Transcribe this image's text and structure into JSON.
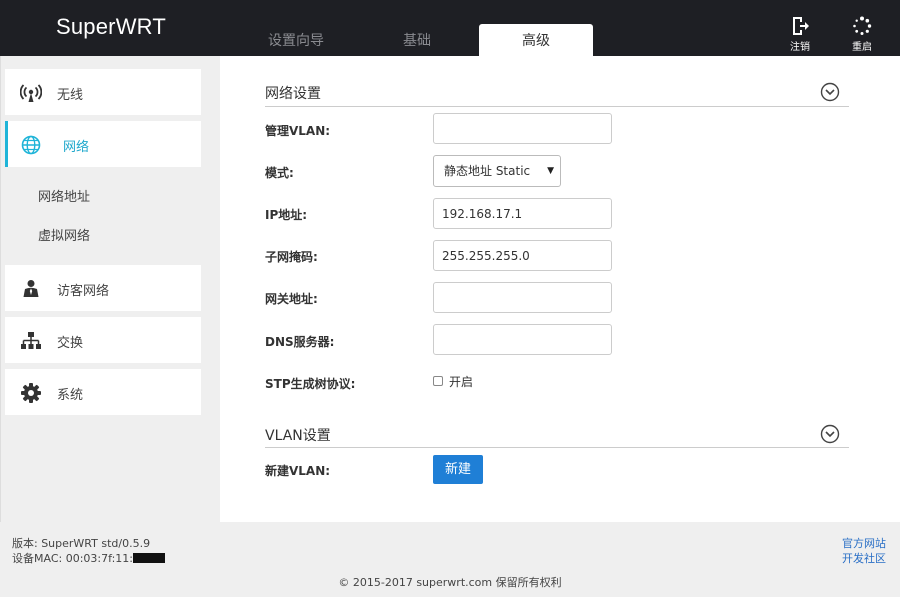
{
  "header": {
    "brand": "SuperWRT",
    "tabs": [
      {
        "label": "设置向导"
      },
      {
        "label": "基础"
      },
      {
        "label": "高级"
      }
    ],
    "logout_label": "注销",
    "reboot_label": "重启"
  },
  "sidebar": {
    "items": [
      {
        "label": "无线",
        "icon": "wifi-icon"
      },
      {
        "label": "网络",
        "icon": "globe-icon"
      },
      {
        "label": "访客网络",
        "icon": "guest-user-icon"
      },
      {
        "label": "交换",
        "icon": "switch-icon"
      },
      {
        "label": "系统",
        "icon": "gear-icon"
      }
    ],
    "sub_items": [
      {
        "label": "网络地址"
      },
      {
        "label": "虚拟网络"
      }
    ]
  },
  "network": {
    "section_title": "网络设置",
    "mgmt_vlan_label": "管理VLAN:",
    "mgmt_vlan_value": "",
    "mode_label": "模式:",
    "mode_value": "静态地址 Static",
    "ip_label": "IP地址:",
    "ip_value": "192.168.17.1",
    "mask_label": "子网掩码:",
    "mask_value": "255.255.255.0",
    "gateway_label": "网关地址:",
    "gateway_value": "",
    "dns_label": "DNS服务器:",
    "dns_value": "",
    "stp_label": "STP生成树协议:",
    "stp_checkbox_label": "开启"
  },
  "vlan": {
    "section_title": "VLAN设置",
    "new_vlan_label": "新建VLAN:",
    "new_button": "新建"
  },
  "footer": {
    "version": "版本: SuperWRT std/0.5.9",
    "mac_prefix": "设备MAC: 00:03:7f:11:",
    "official_site": "官方网站",
    "dev_community": "开发社区",
    "copyright": "© 2015-2017 superwrt.com 保留所有权利"
  },
  "colors": {
    "header_bg": "#1e1f24",
    "accent": "#1fb4d8",
    "button_blue": "#1f7fd6",
    "link_blue": "#2a6fc6"
  }
}
